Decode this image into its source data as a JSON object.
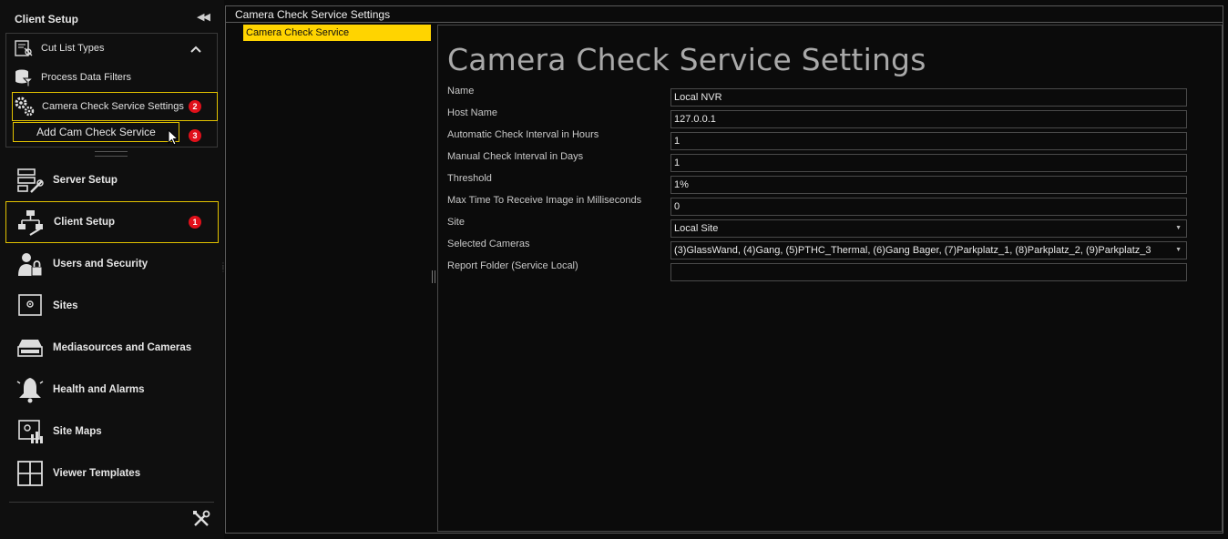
{
  "sidebar": {
    "title": "Client Setup",
    "collapse_icon": "double-chevron-left-icon",
    "sub_items": [
      {
        "label": "Cut List Types",
        "icon": "cut-list-icon"
      },
      {
        "label": "Process Data Filters",
        "icon": "database-filter-icon"
      },
      {
        "label": "Camera Check Service Settings",
        "icon": "gears-icon",
        "badge": "2"
      }
    ],
    "add_button": {
      "label": "Add Cam Check Service",
      "badge": "3"
    },
    "nav_items": [
      {
        "label": "Server Setup",
        "icon": "server-setup-icon"
      },
      {
        "label": "Client Setup",
        "icon": "client-setup-icon",
        "badge": "1"
      },
      {
        "label": "Users and Security",
        "icon": "users-icon"
      },
      {
        "label": "Sites",
        "icon": "sites-icon"
      },
      {
        "label": "Mediasources and Cameras",
        "icon": "mediasource-icon"
      },
      {
        "label": "Health and Alarms",
        "icon": "bell-icon"
      },
      {
        "label": "Site Maps",
        "icon": "site-map-icon"
      },
      {
        "label": "Viewer Templates",
        "icon": "grid-icon"
      }
    ],
    "footer_icon": "tools-icon"
  },
  "main": {
    "header_title": "Camera Check Service Settings",
    "tree_item": "Camera Check Service",
    "settings_title": "Camera Check Service Settings",
    "fields": [
      {
        "label": "Name",
        "value": "Local NVR"
      },
      {
        "label": "Host Name",
        "value": "127.0.0.1"
      },
      {
        "label": "Automatic Check Interval in Hours",
        "value": "1"
      },
      {
        "label": "Manual Check Interval in Days",
        "value": "1"
      },
      {
        "label": "Threshold",
        "value": "1%"
      },
      {
        "label": "Max Time To Receive Image in Milliseconds",
        "value": "0"
      },
      {
        "label": "Site",
        "value": "Local Site",
        "dropdown": true
      },
      {
        "label": "Selected Cameras",
        "value": "(3)GlassWand, (4)Gang, (5)PTHC_Thermal, (6)Gang Bager, (7)Parkplatz_1, (8)Parkplatz_2, (9)Parkplatz_3",
        "dropdown": true
      },
      {
        "label": "Report Folder (Service Local)",
        "value": ""
      }
    ]
  },
  "colors": {
    "accent": "#e2c200",
    "selection": "#ffd400",
    "badge": "#e0101a",
    "background": "#0b0b0b"
  }
}
